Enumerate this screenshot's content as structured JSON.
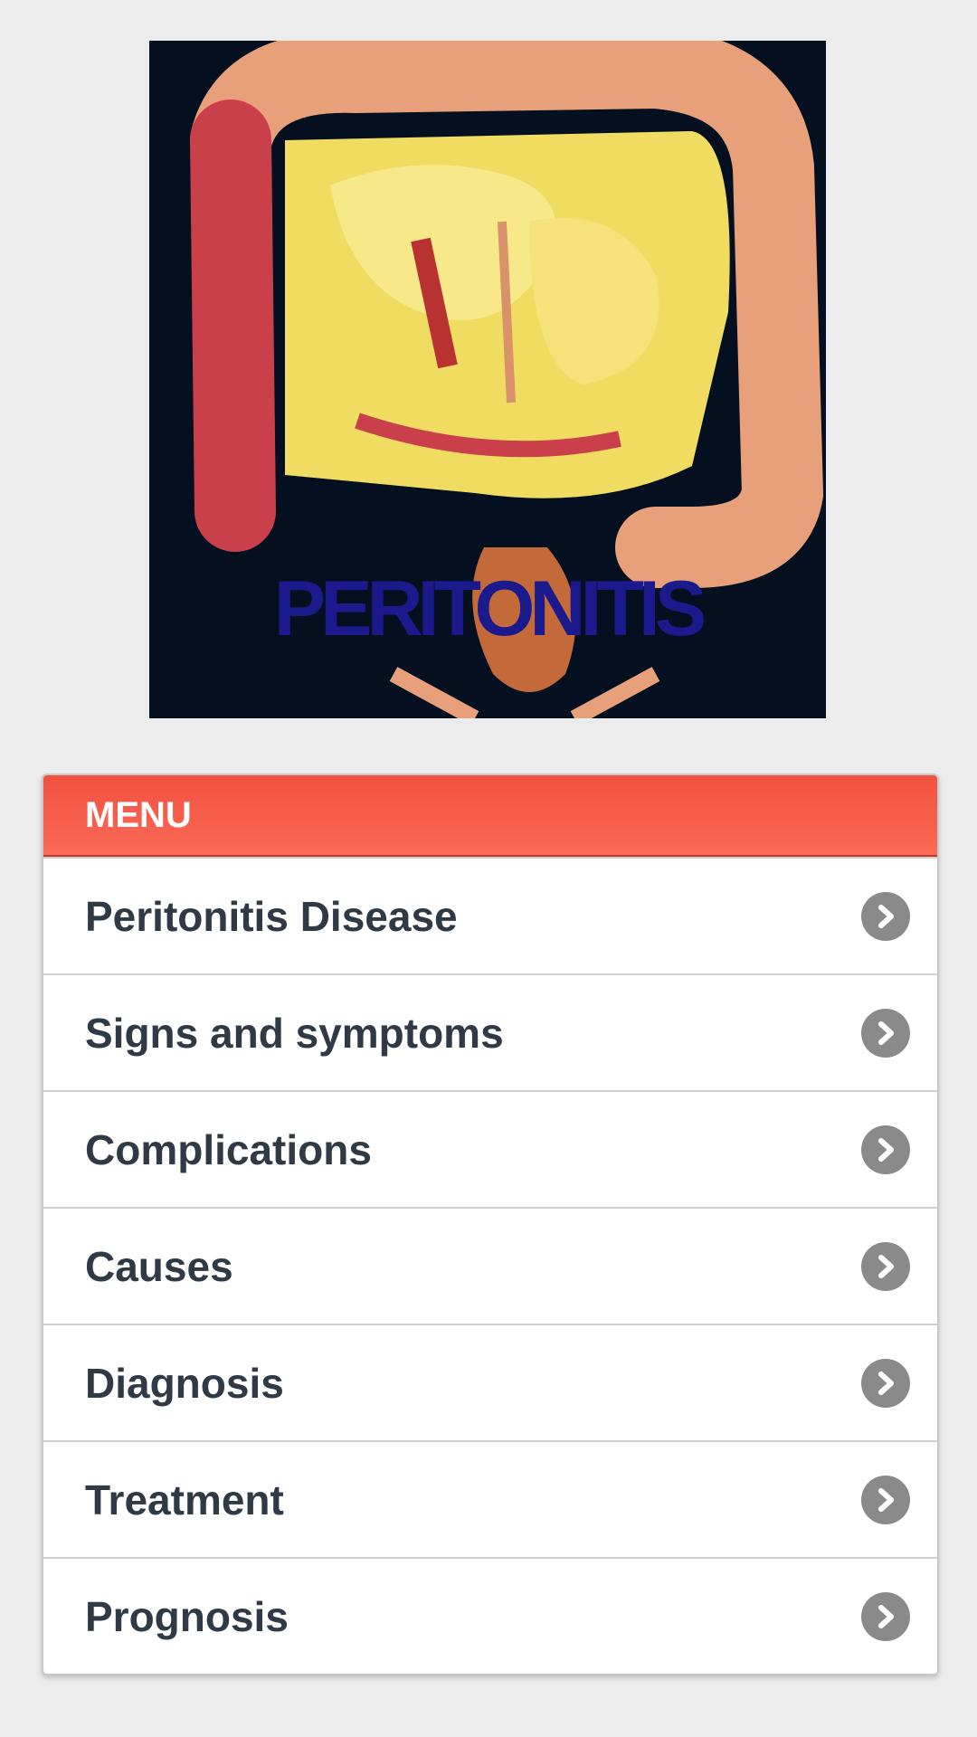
{
  "hero": {
    "image": "peritonitis-abdomen-illustration",
    "title": "PERITONITIS"
  },
  "menu": {
    "header": "MENU",
    "items": [
      {
        "label": "Peritonitis Disease",
        "icon": "chevron-right-icon"
      },
      {
        "label": "Signs and symptoms",
        "icon": "chevron-right-icon"
      },
      {
        "label": "Complications",
        "icon": "chevron-right-icon"
      },
      {
        "label": "Causes",
        "icon": "chevron-right-icon"
      },
      {
        "label": "Diagnosis",
        "icon": "chevron-right-icon"
      },
      {
        "label": "Treatment",
        "icon": "chevron-right-icon"
      },
      {
        "label": "Prognosis",
        "icon": "chevron-right-icon"
      }
    ]
  },
  "colors": {
    "background": "#ececec",
    "header_accent": "#f65a48",
    "title_blue": "#1a1a8c",
    "item_text": "#2f3a46",
    "chevron": "#8a8a8a"
  }
}
